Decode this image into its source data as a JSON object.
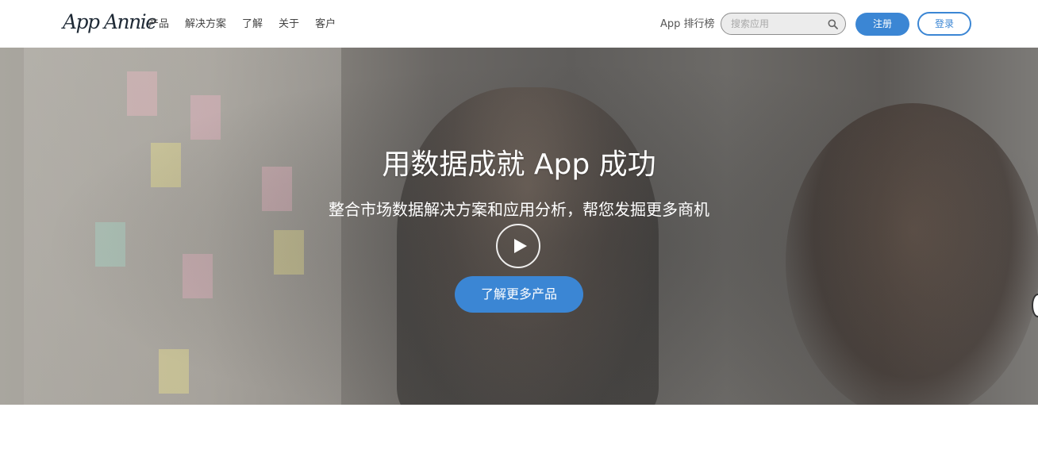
{
  "header": {
    "logo": "App Annie",
    "nav": [
      "产品",
      "解决方案",
      "了解",
      "关于",
      "客户"
    ],
    "rank_link": "App 排行榜",
    "search": {
      "placeholder": "搜索应用",
      "value": ""
    },
    "signup": "注册",
    "login": "登录"
  },
  "hero": {
    "title": "用数据成就 App 成功",
    "subtitle": "整合市场数据解决方案和应用分析，帮您发掘更多商机",
    "cta": "了解更多产品"
  },
  "colors": {
    "accent": "#3b86d4",
    "logo": "#1f2a36"
  },
  "icons": {
    "search": "search-icon",
    "play": "play-icon"
  }
}
